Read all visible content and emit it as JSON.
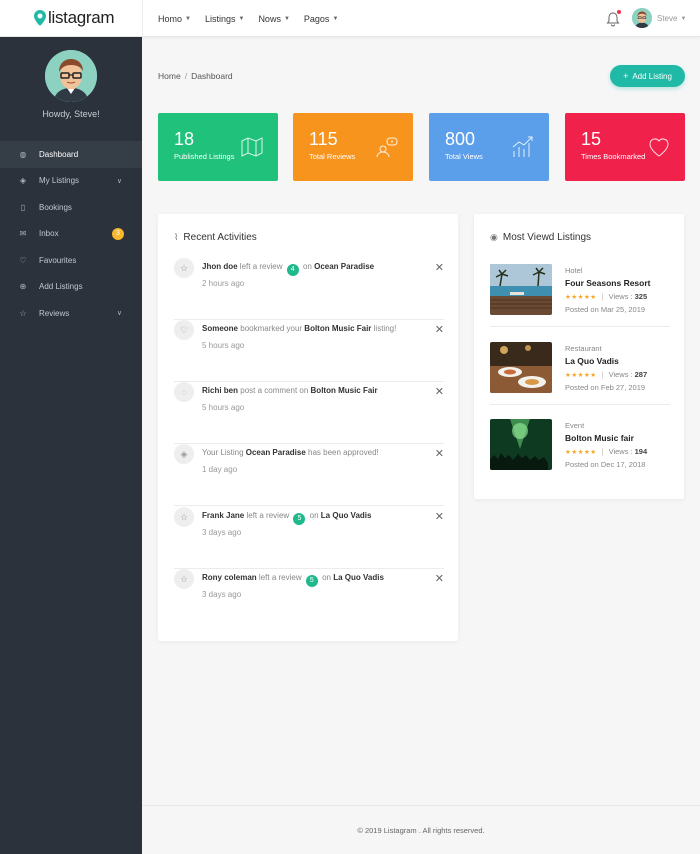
{
  "app": {
    "logo_text": "listagram",
    "brand_color": "#1fb9a5"
  },
  "topnav": {
    "items": [
      {
        "label": "Homo"
      },
      {
        "label": "Listings"
      },
      {
        "label": "Nows"
      },
      {
        "label": "Pagos"
      }
    ],
    "user_name": "Steve"
  },
  "sidebar": {
    "greeting": "Howdy, Steve!",
    "items": [
      {
        "label": "Dashboard",
        "icon": "dashboard-icon",
        "active": true
      },
      {
        "label": "My Listings",
        "icon": "layers-icon"
      },
      {
        "label": "Bookings",
        "icon": "file-icon"
      },
      {
        "label": "Inbox",
        "icon": "mail-icon",
        "badge": "3"
      },
      {
        "label": "Favourites",
        "icon": "heart-icon"
      },
      {
        "label": "Add Listings",
        "icon": "plus-circle-icon"
      },
      {
        "label": "Reviews",
        "icon": "star-icon"
      }
    ]
  },
  "breadcrumb": {
    "home": "Home",
    "current": "Dashboard"
  },
  "add_listing_label": "Add Listing",
  "stats": [
    {
      "value": "18",
      "label": "Published Listings",
      "color": "#1fc17b",
      "icon": "map-icon"
    },
    {
      "value": "115",
      "label": "Total Reviews",
      "color": "#f7941d",
      "icon": "chat-user-icon"
    },
    {
      "value": "800",
      "label": "Total Views",
      "color": "#5b9ee9",
      "icon": "chart-icon"
    },
    {
      "value": "15",
      "label": "Times Bookmarked",
      "color": "#f0214b",
      "icon": "heart-icon"
    }
  ],
  "activities": {
    "title": "Recent Activities",
    "items": [
      {
        "icon": "star-icon",
        "actor": "Jhon doe",
        "mid": "left a review",
        "badge": "4",
        "pre_target": "on",
        "target": "Ocean Paradise",
        "tail": "",
        "time": "2 hours ago"
      },
      {
        "icon": "heart-icon",
        "actor": "Someone",
        "mid": "bookmarked your",
        "badge": "",
        "pre_target": "",
        "target": "Bolton Music Fair",
        "tail": "listing!",
        "time": "5 hours ago"
      },
      {
        "icon": "comment-icon",
        "actor": "Richi ben",
        "mid": "post a comment on",
        "badge": "",
        "pre_target": "",
        "target": "Bolton Music Fair",
        "tail": "",
        "time": "5 hours ago"
      },
      {
        "icon": "layers-icon",
        "actor": "",
        "mid": "Your Listing",
        "badge": "",
        "pre_target": "",
        "target": "Ocean Paradise",
        "tail": "has been approved!",
        "time": "1 day ago"
      },
      {
        "icon": "star-icon",
        "actor": "Frank Jane",
        "mid": "left a review",
        "badge": "5",
        "pre_target": "on",
        "target": "La Quo Vadis",
        "tail": "",
        "time": "3 days ago"
      },
      {
        "icon": "star-icon",
        "actor": "Rony coleman",
        "mid": "left a review",
        "badge": "5",
        "pre_target": "on",
        "target": "La Quo Vadis",
        "tail": "",
        "time": "3 days ago"
      }
    ]
  },
  "most_viewed": {
    "title": "Most Viewd Listings",
    "items": [
      {
        "category": "Hotel",
        "name": "Four Seasons Resort",
        "stars": "★★★★★",
        "views_label": "Views :",
        "views": "325",
        "posted": "Posted on Mar 25, 2019"
      },
      {
        "category": "Restaurant",
        "name": "La Quo Vadis",
        "stars": "★★★★★",
        "views_label": "Views :",
        "views": "287",
        "posted": "Posted on Feb 27, 2019"
      },
      {
        "category": "Event",
        "name": "Bolton Music fair",
        "stars": "★★★★★",
        "views_label": "Views :",
        "views": "194",
        "posted": "Posted on Dec 17, 2018"
      }
    ]
  },
  "footer": {
    "text": "© 2019 Listagram . All rights reserved."
  }
}
